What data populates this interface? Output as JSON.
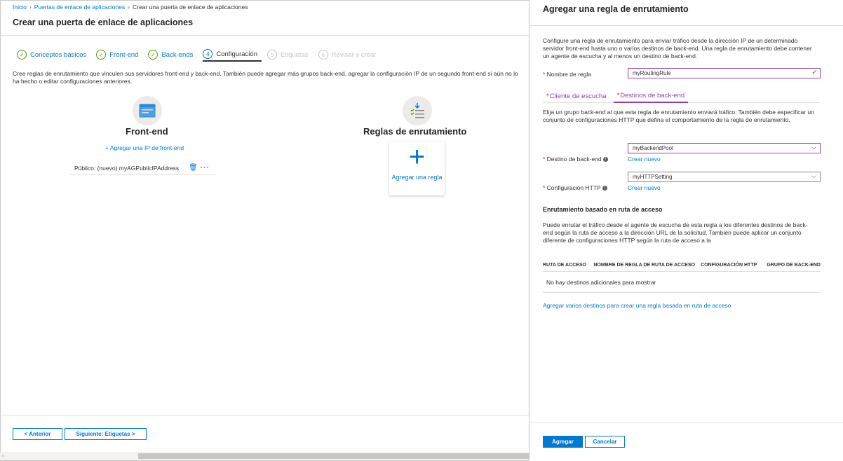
{
  "breadcrumb": {
    "home": "Inicio",
    "gateways": "Puertas de enlace de aplicaciones",
    "current": "Crear una puerta de enlace de aplicaciones"
  },
  "page_title": "Crear una puerta de enlace de aplicaciones",
  "tabs": [
    {
      "label": "Conceptos básicos",
      "icon": "✓",
      "state": "done"
    },
    {
      "label": "Front-end",
      "icon": "✓",
      "state": "done"
    },
    {
      "label": "Back-ends",
      "icon": "✓",
      "state": "done"
    },
    {
      "label": "Configuración",
      "icon": "4",
      "state": "active"
    },
    {
      "label": "Etiquetas",
      "icon": "5",
      "state": "disabled"
    },
    {
      "label": "Revisar y crear",
      "icon": "6",
      "state": "disabled"
    }
  ],
  "description": "Cree reglas de enrutamiento que vinculen sus servidores front-end y back-end. También puede agregar más grupos back-end, agregar la configuración IP de un segundo front-end si aún no lo ha hecho o editar configuraciones anteriores.",
  "frontend": {
    "title": "Front-end",
    "add_link": "+ Agregar una IP de front-end",
    "entry": "Público: (nuevo) myAGPublicIPAddress",
    "more": "···"
  },
  "routing": {
    "title": "Reglas de enrutamiento",
    "add_label": "Agregar una regla",
    "plus": "+"
  },
  "footer": {
    "prev": "< Anterior",
    "next": "Siguiente: Etiquetas >"
  },
  "panel": {
    "title": "Agregar una regla de enrutamiento",
    "intro": "Configure una regla de enrutamiento para enviar tráfico desde la dirección IP de un determinado servidor front-end hasta uno o varios destinos de back-end. Una regla de enrutamiento debe contener un agente de escucha y al menos un destino de back-end.",
    "rule_name_label": "Nombre de regla",
    "rule_name_value": "myRoutingRule",
    "tab_listener": "Cliente de escucha",
    "tab_targets": "Destinos de back-end",
    "targets_text": "Elija un grupo back-end al que esta regla de enrutamiento enviará tráfico. También debe especificar un conjunto de configuraciones HTTP que defina el comportamiento de la regla de enrutamiento.",
    "backend_label": "Destino de back-end",
    "backend_value": "myBackendPool",
    "http_label": "Configuración HTTP",
    "http_value": "myHTTPSetting",
    "create_new": "Crear nuevo",
    "path_heading": "Enrutamiento basado en ruta de acceso",
    "path_text": "Puede enrutar el tráfico desde el agente de escucha de esta regla a los diferentes destinos de back-end según la ruta de acceso a la dirección URL de la solicitud. También puede aplicar un conjunto diferente de configuraciones HTTP según la ruta de acceso a la",
    "columns": [
      "RUTA DE ACCESO",
      "NOMBRE DE REGLA DE RUTA DE ACCESO",
      "CONFIGURACIÓN HTTP",
      "GRUPO DE BACK-END"
    ],
    "empty_text": "No hay destinos adicionales para mostrar",
    "multi_link": "Agregar varios destinos para crear una regla basada en ruta de acceso",
    "add_button": "Agregar",
    "cancel_button": "Cancelar"
  },
  "colors": {
    "accent": "#0078d4",
    "success": "#57a300",
    "purple": "#8e44ad"
  }
}
